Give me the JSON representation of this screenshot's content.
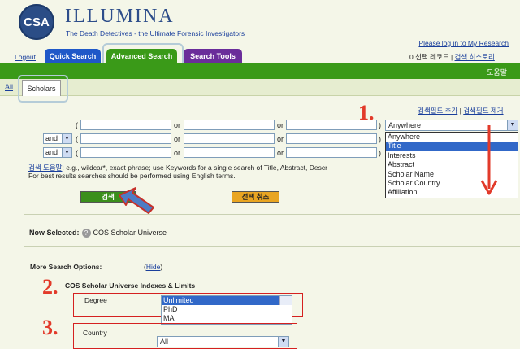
{
  "header": {
    "logo": "CSA",
    "brand": "ILLUMINA",
    "tagline": "The Death Detectives - the Ultimate Forensic Investigators",
    "login_link": "Please log in to My Research",
    "logout": "Logout",
    "records_label": "0 선택 레코드",
    "records_sep": "|",
    "history_link": "검색 히스토리"
  },
  "tabs": {
    "quick": "Quick Search",
    "advanced": "Advanced Search",
    "tools": "Search Tools"
  },
  "help": "도움말",
  "subtabs": {
    "all": "All",
    "scholars": "Scholars"
  },
  "field_links": {
    "add": "검색필드 추가",
    "sep": "|",
    "remove": "검색필드 제거"
  },
  "rows": {
    "open_paren": "(",
    "close_paren": ")",
    "or": "or",
    "and": "and"
  },
  "field_select": {
    "selected": "Anywhere",
    "options": [
      "Anywhere",
      "Title",
      "Interests",
      "Abstract",
      "Scholar Name",
      "Scholar Country",
      "Affiliation"
    ],
    "highlighted": "Title"
  },
  "hint": {
    "link": "검색 도움말",
    "text": ": e.g., wildcar*, exact phrase; use Keywords for a single search of Title, Abstract, Descr",
    "line2": "For best results searches should be performed using English terms."
  },
  "buttons": {
    "search": "검색",
    "cancel": "선택 취소"
  },
  "now_selected": {
    "label": "Now Selected:",
    "icon": "?",
    "value": "COS Scholar Universe"
  },
  "more_options": {
    "label": "More Search Options:",
    "hide_open": "(",
    "hide": "Hide",
    "hide_close": ")"
  },
  "indexes_title": "COS Scholar Universe Indexes & Limits",
  "degree": {
    "label": "Degree",
    "options": [
      "Unlimited",
      "PhD",
      "MA"
    ]
  },
  "country": {
    "label": "Country",
    "selected": "All"
  },
  "annotations": {
    "one": "1.",
    "two": "2.",
    "three": "3.",
    "red": "#e23a2a",
    "blue": "#4d7cc4"
  },
  "colors": {
    "green": "#3a9a18",
    "blue_tab": "#1f58c8",
    "purple_tab": "#6a2d9a",
    "search_btn": "#3b8f1c",
    "cancel_btn": "#e9a522"
  }
}
